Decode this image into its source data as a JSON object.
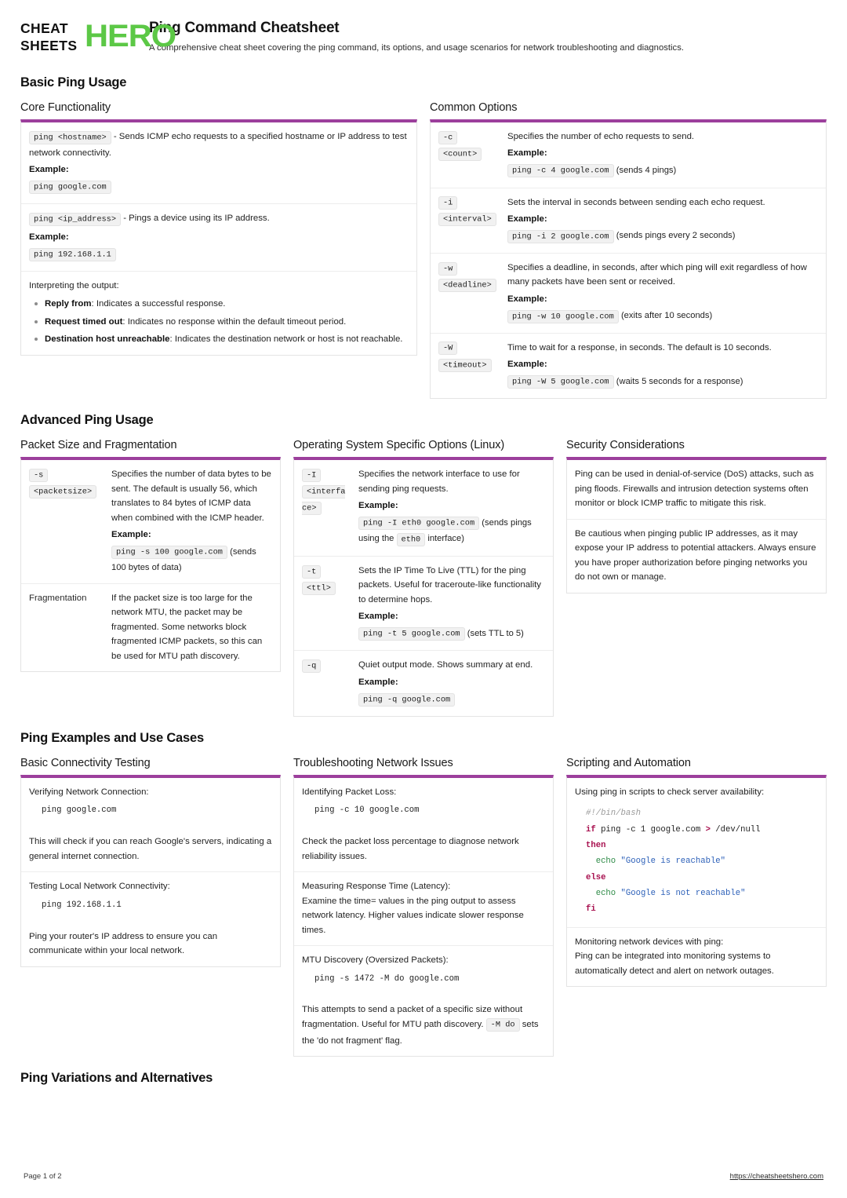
{
  "brand": {
    "logo_line1": "CHEAT",
    "logo_line2": "SHEETS",
    "logo_accent": "HERO",
    "accent_green": "#5cc846",
    "accent_purple": "#9c3f9c"
  },
  "header": {
    "title": "Ping Command Cheatsheet",
    "subtitle": "A comprehensive cheat sheet covering the ping command, its options, and usage scenarios for network troubleshooting and diagnostics."
  },
  "sections": {
    "basic": {
      "title": "Basic Ping Usage",
      "core": {
        "title": "Core Functionality",
        "rows": [
          {
            "code": "ping <hostname>",
            "desc": " - Sends ICMP echo requests to a specified hostname or IP address to test network connectivity.",
            "example_label": "Example:",
            "example": "ping google.com"
          },
          {
            "code": "ping <ip_address>",
            "desc": " - Pings a device using its IP address.",
            "example_label": "Example:",
            "example": "ping 192.168.1.1"
          }
        ],
        "interpret_label": "Interpreting the output:",
        "bullets": [
          {
            "term": "Reply from",
            "text": ": Indicates a successful response."
          },
          {
            "term": "Request timed out",
            "text": ": Indicates no response within the default timeout period."
          },
          {
            "term": "Destination host unreachable",
            "text": ": Indicates the destination network or host is not reachable."
          }
        ]
      },
      "common": {
        "title": "Common Options",
        "rows": [
          {
            "opt_flag": "-c",
            "opt_arg": "<count>",
            "desc": "Specifies the number of echo requests to send.",
            "example_label": "Example:",
            "example": "ping -c 4 google.com",
            "example_note": "(sends 4 pings)"
          },
          {
            "opt_flag": "-i",
            "opt_arg": "<interval>",
            "desc": "Sets the interval in seconds between sending each echo request.",
            "example_label": "Example:",
            "example": "ping -i 2 google.com",
            "example_note": "(sends pings every 2 seconds)"
          },
          {
            "opt_flag": "-w",
            "opt_arg": "<deadline>",
            "desc": "Specifies a deadline, in seconds, after which ping will exit regardless of how many packets have been sent or received.",
            "example_label": "Example:",
            "example": "ping -w 10 google.com",
            "example_note": "(exits after 10 seconds)"
          },
          {
            "opt_flag": "-W",
            "opt_arg": "<timeout>",
            "desc": "Time to wait for a response, in seconds. The default is 10 seconds.",
            "example_label": "Example:",
            "example": "ping -W 5 google.com",
            "example_note": "(waits 5 seconds for a response)"
          }
        ]
      }
    },
    "advanced": {
      "title": "Advanced Ping Usage",
      "packet": {
        "title": "Packet Size and Fragmentation",
        "row1": {
          "opt_flag": "-s",
          "opt_arg": "<packetsize>",
          "desc": "Specifies the number of data bytes to be sent. The default is usually 56, which translates to 84 bytes of ICMP data when combined with the ICMP header.",
          "example_label": "Example:",
          "example": "ping -s 100 google.com",
          "example_note": "(sends 100 bytes of data)"
        },
        "row2": {
          "opt_label": "Fragmentation",
          "desc": "If the packet size is too large for the network MTU, the packet may be fragmented. Some networks block fragmented ICMP packets, so this can be used for MTU path discovery."
        }
      },
      "os": {
        "title": "Operating System Specific Options (Linux)",
        "rows": [
          {
            "opt_flag": "-I",
            "opt_arg": "<interface>",
            "desc": "Specifies the network interface to use for sending ping requests.",
            "example_label": "Example:",
            "example": "ping -I eth0 google.com",
            "example_note_pre": "(sends pings using the ",
            "example_note_code": "eth0",
            "example_note_post": " interface)"
          },
          {
            "opt_flag": "-t",
            "opt_arg": "<ttl>",
            "desc": "Sets the IP Time To Live (TTL) for the ping packets. Useful for traceroute-like functionality to determine hops.",
            "example_label": "Example:",
            "example": "ping -t 5 google.com",
            "example_note": "(sets TTL to 5)"
          },
          {
            "opt_flag": "-q",
            "opt_arg": "",
            "desc": "Quiet output mode. Shows summary at end.",
            "example_label": "Example:",
            "example": "ping -q google.com",
            "example_note": ""
          }
        ]
      },
      "security": {
        "title": "Security Considerations",
        "paragraphs": [
          "Ping can be used in denial-of-service (DoS) attacks, such as ping floods. Firewalls and intrusion detection systems often monitor or block ICMP traffic to mitigate this risk.",
          "Be cautious when pinging public IP addresses, as it may expose your IP address to potential attackers. Always ensure you have proper authorization before pinging networks you do not own or manage."
        ]
      }
    },
    "examples": {
      "title": "Ping Examples and Use Cases",
      "basic_conn": {
        "title": "Basic Connectivity Testing",
        "rows": [
          {
            "lead": "Verifying Network Connection:",
            "code": "ping google.com",
            "note": "This will check if you can reach Google's servers, indicating a general internet connection."
          },
          {
            "lead": "Testing Local Network Connectivity:",
            "code": "ping 192.168.1.1",
            "note": "Ping your router's IP address to ensure you can communicate within your local network."
          }
        ]
      },
      "trouble": {
        "title": "Troubleshooting Network Issues",
        "rows": [
          {
            "lead": "Identifying Packet Loss:",
            "code": "ping -c 10 google.com",
            "note": "Check the packet loss percentage to diagnose network reliability issues."
          },
          {
            "lead": "Measuring Response Time (Latency):",
            "note": "Examine the time= values in the ping output to assess network latency. Higher values indicate slower response times."
          },
          {
            "lead": "MTU Discovery (Oversized Packets):",
            "code": "ping -s 1472 -M do google.com",
            "note_pre": "This attempts to send a packet of a specific size without fragmentation. Useful for MTU path discovery. ",
            "note_code": "-M do",
            "note_post": " sets the 'do not fragment' flag."
          }
        ]
      },
      "scripting": {
        "title": "Scripting and Automation",
        "row1_lead": "Using ping in scripts to check server availability:",
        "script_lines": [
          {
            "type": "comment",
            "text": "#!/bin/bash"
          },
          {
            "type": "code",
            "text": "if ping -c 1 google.com > /dev/null"
          },
          {
            "type": "keyword",
            "text": "then"
          },
          {
            "type": "echo",
            "text": "echo \"Google is reachable\""
          },
          {
            "type": "keyword",
            "text": "else"
          },
          {
            "type": "echo",
            "text": "echo \"Google is not reachable\""
          },
          {
            "type": "keyword",
            "text": "fi"
          }
        ],
        "row2_lead": "Monitoring network devices with ping:",
        "row2_note": "Ping can be integrated into monitoring systems to automatically detect and alert on network outages."
      }
    },
    "variations": {
      "title": "Ping Variations and Alternatives"
    }
  },
  "footer": {
    "page": "Page 1 of 2",
    "url": "https://cheatsheetshero.com"
  }
}
